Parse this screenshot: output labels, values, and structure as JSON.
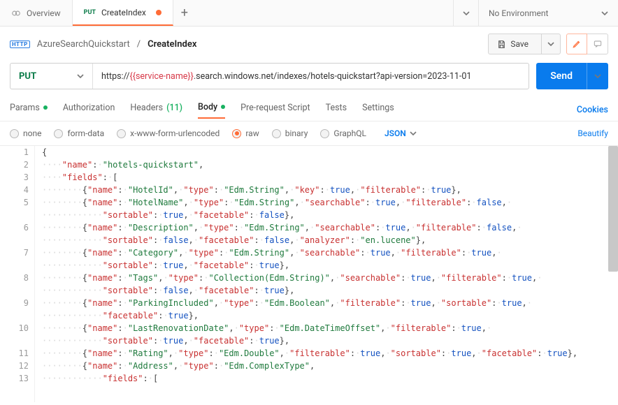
{
  "tabs": {
    "overview": {
      "label": "Overview"
    },
    "createindex": {
      "method": "PUT",
      "label": "CreateIndex"
    },
    "plus": "+"
  },
  "env": {
    "label": "No Environment"
  },
  "breadcrumb": {
    "http_badge": "HTTP",
    "collection": "AzureSearchQuickstart",
    "sep": "/",
    "request": "CreateIndex"
  },
  "toolbar": {
    "save": "Save"
  },
  "url": {
    "method": "PUT",
    "prefix": "https://",
    "template": "{{service-name}}",
    "suffix": ".search.windows.net/indexes/hotels-quickstart?api-version=2023-11-01"
  },
  "send": {
    "label": "Send"
  },
  "subtabs": {
    "params": "Params",
    "auth": "Authorization",
    "headers": "Headers",
    "headers_count": "(11)",
    "body": "Body",
    "prerequest": "Pre-request Script",
    "tests": "Tests",
    "settings": "Settings",
    "cookies": "Cookies"
  },
  "bodytypes": {
    "none": "none",
    "formdata": "form-data",
    "xwww": "x-www-form-urlencoded",
    "raw": "raw",
    "binary": "binary",
    "graphql": "GraphQL",
    "lang": "JSON",
    "beautify": "Beautify"
  },
  "code": {
    "dot": "·",
    "l1": "{",
    "l2": {
      "k": "\"name\"",
      "v": "\"hotels-quickstart\""
    },
    "l3_k": "\"fields\"",
    "fields": [
      {
        "pairs": [
          [
            "\"name\"",
            "\"HotelId\""
          ],
          [
            "\"type\"",
            "\"Edm.String\""
          ],
          [
            "\"key\"",
            "true"
          ],
          [
            "\"filterable\"",
            "true"
          ]
        ]
      },
      {
        "pairs": [
          [
            "\"name\"",
            "\"HotelName\""
          ],
          [
            "\"type\"",
            "\"Edm.String\""
          ],
          [
            "\"searchable\"",
            "true"
          ],
          [
            "\"filterable\"",
            "false"
          ],
          [
            "\"sortable\"",
            "true"
          ],
          [
            "\"facetable\"",
            "false"
          ]
        ],
        "wrap": 4
      },
      {
        "pairs": [
          [
            "\"name\"",
            "\"Description\""
          ],
          [
            "\"type\"",
            "\"Edm.String\""
          ],
          [
            "\"searchable\"",
            "true"
          ],
          [
            "\"filterable\"",
            "false"
          ],
          [
            "\"sortable\"",
            "false"
          ],
          [
            "\"facetable\"",
            "false"
          ],
          [
            "\"analyzer\"",
            "\"en.lucene\""
          ]
        ],
        "wrap": 4
      },
      {
        "pairs": [
          [
            "\"name\"",
            "\"Category\""
          ],
          [
            "\"type\"",
            "\"Edm.String\""
          ],
          [
            "\"searchable\"",
            "true"
          ],
          [
            "\"filterable\"",
            "true"
          ],
          [
            "\"sortable\"",
            "true"
          ],
          [
            "\"facetable\"",
            "true"
          ]
        ],
        "wrap": 4
      },
      {
        "pairs": [
          [
            "\"name\"",
            "\"Tags\""
          ],
          [
            "\"type\"",
            "\"Collection(Edm.String)\""
          ],
          [
            "\"searchable\"",
            "true"
          ],
          [
            "\"filterable\"",
            "true"
          ],
          [
            "\"sortable\"",
            "false"
          ],
          [
            "\"facetable\"",
            "true"
          ]
        ],
        "wrap": 4
      },
      {
        "pairs": [
          [
            "\"name\"",
            "\"ParkingIncluded\""
          ],
          [
            "\"type\"",
            "\"Edm.Boolean\""
          ],
          [
            "\"filterable\"",
            "true"
          ],
          [
            "\"sortable\"",
            "true"
          ],
          [
            "\"facetable\"",
            "true"
          ]
        ],
        "wrap": 4
      },
      {
        "pairs": [
          [
            "\"name\"",
            "\"LastRenovationDate\""
          ],
          [
            "\"type\"",
            "\"Edm.DateTimeOffset\""
          ],
          [
            "\"filterable\"",
            "true"
          ],
          [
            "\"sortable\"",
            "true"
          ],
          [
            "\"facetable\"",
            "true"
          ]
        ],
        "wrap": 3
      },
      {
        "pairs": [
          [
            "\"name\"",
            "\"Rating\""
          ],
          [
            "\"type\"",
            "\"Edm.Double\""
          ],
          [
            "\"filterable\"",
            "true"
          ],
          [
            "\"sortable\"",
            "true"
          ],
          [
            "\"facetable\"",
            "true"
          ]
        ]
      },
      {
        "open": true,
        "pairs": [
          [
            "\"name\"",
            "\"Address\""
          ],
          [
            "\"type\"",
            "\"Edm.ComplexType\""
          ]
        ]
      }
    ],
    "inner_fields_k": "\"fields\""
  }
}
